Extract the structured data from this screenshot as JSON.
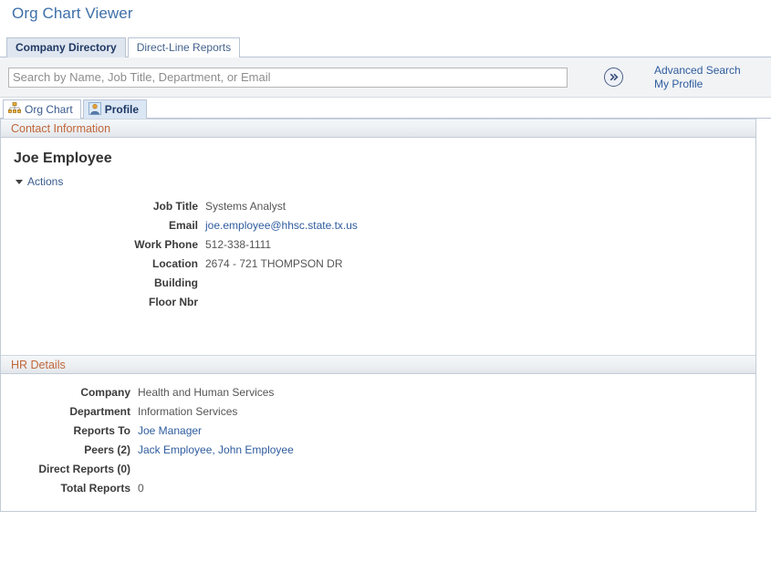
{
  "page": {
    "title": "Org Chart Viewer"
  },
  "tabs": [
    {
      "label": "Company Directory",
      "active": true
    },
    {
      "label": "Direct-Line Reports",
      "active": false
    }
  ],
  "search": {
    "value": "",
    "placeholder": "Search by Name, Job Title, Department, or Email",
    "go_icon": "double-chevron-right-icon",
    "links": [
      {
        "label": "Advanced Search"
      },
      {
        "label": "My Profile"
      }
    ]
  },
  "subtabs": [
    {
      "label": "Org Chart",
      "icon": "org-chart-icon",
      "active": false
    },
    {
      "label": "Profile",
      "icon": "person-icon",
      "active": true
    }
  ],
  "contact": {
    "header": "Contact Information",
    "employee_name": "Joe Employee",
    "actions_label": "Actions",
    "actions_icon": "caret-down-icon",
    "fields": [
      {
        "label": "Job Title",
        "value": "Systems Analyst",
        "link": false
      },
      {
        "label": "Email",
        "value": "joe.employee@hhsc.state.tx.us",
        "link": true
      },
      {
        "label": "Work Phone",
        "value": "512-338-1111",
        "link": false
      },
      {
        "label": "Location",
        "value": "2674 - 721 THOMPSON DR",
        "link": false
      },
      {
        "label": "Building",
        "value": "",
        "link": false
      },
      {
        "label": "Floor Nbr",
        "value": "",
        "link": false
      }
    ]
  },
  "hr": {
    "header": "HR Details",
    "fields": [
      {
        "label": "Company",
        "value": "Health and Human Services",
        "link": false
      },
      {
        "label": "Department",
        "value": "Information Services",
        "link": false
      },
      {
        "label": "Reports To",
        "value": "Joe Manager",
        "link": true
      },
      {
        "label": "Peers (2)",
        "value": "Jack Employee, John Employee",
        "link": true
      },
      {
        "label": "Direct Reports (0)",
        "value": "",
        "link": false
      },
      {
        "label": "Total Reports",
        "value": "0",
        "link": false
      }
    ]
  },
  "colors": {
    "title_blue": "#3e6fa8",
    "link_blue": "#2f5c9e",
    "section_orange": "#c0663a",
    "tab_active_bg": "#dfe6ef",
    "subtab_active_bg": "#dbe7f4",
    "band_bg": "#f1f3f5",
    "border": "#c3cbd6"
  }
}
